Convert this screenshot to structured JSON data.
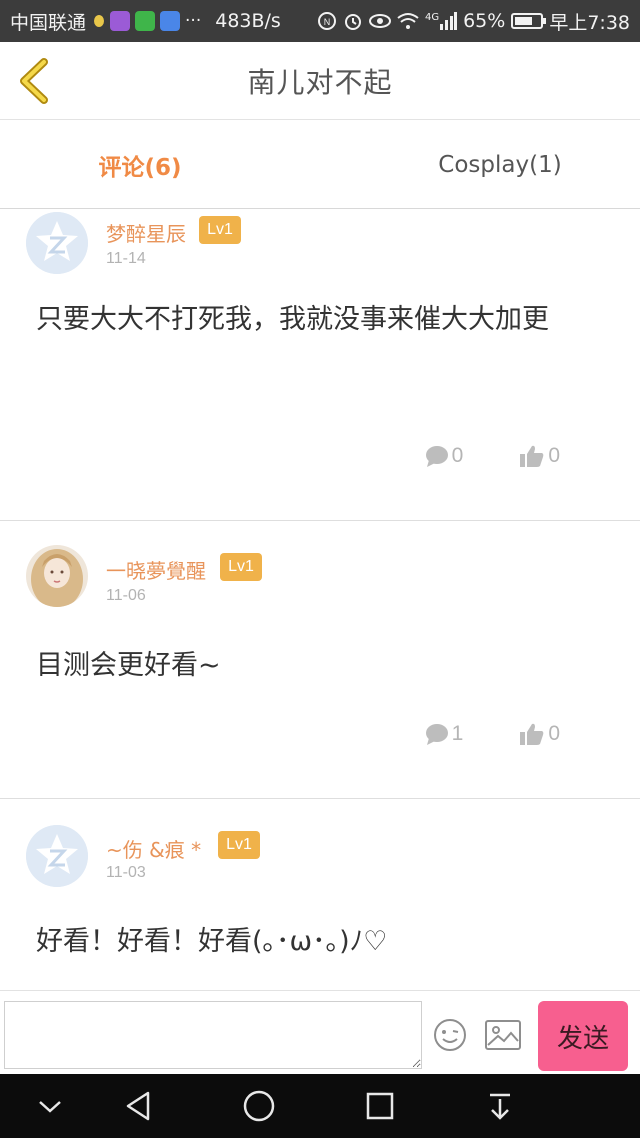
{
  "status_bar": {
    "carrier": "中国联通",
    "speed": "483B/s",
    "network": "4G",
    "battery": "65%",
    "battery_level": 0.65,
    "time": "早上7:38"
  },
  "header": {
    "title": "南儿对不起"
  },
  "tabs": [
    {
      "label": "评论(6)",
      "active": true
    },
    {
      "label": "Cosplay(1)",
      "active": false
    }
  ],
  "comments": [
    {
      "username": "梦醉星辰",
      "level": "Lv1",
      "date": "11-14",
      "text": "只要大大不打死我，我就没事来催大大加更",
      "reply_count": "0",
      "like_count": "0"
    },
    {
      "username": "一晓夢覺醒",
      "level": "Lv1",
      "date": "11-06",
      "text": "目测会更好看~",
      "reply_count": "1",
      "like_count": "0"
    },
    {
      "username": "~伤 &痕 *",
      "level": "Lv1",
      "date": "11-03",
      "text": "好看！好看！好看(｡･ω･｡)ﾉ♡"
    }
  ],
  "input_bar": {
    "placeholder": "",
    "send_label": "发送"
  },
  "colors": {
    "accent": "#f08a45",
    "username": "#e8945a",
    "level_badge": "#f0b24a",
    "send_button": "#f75f8f"
  }
}
